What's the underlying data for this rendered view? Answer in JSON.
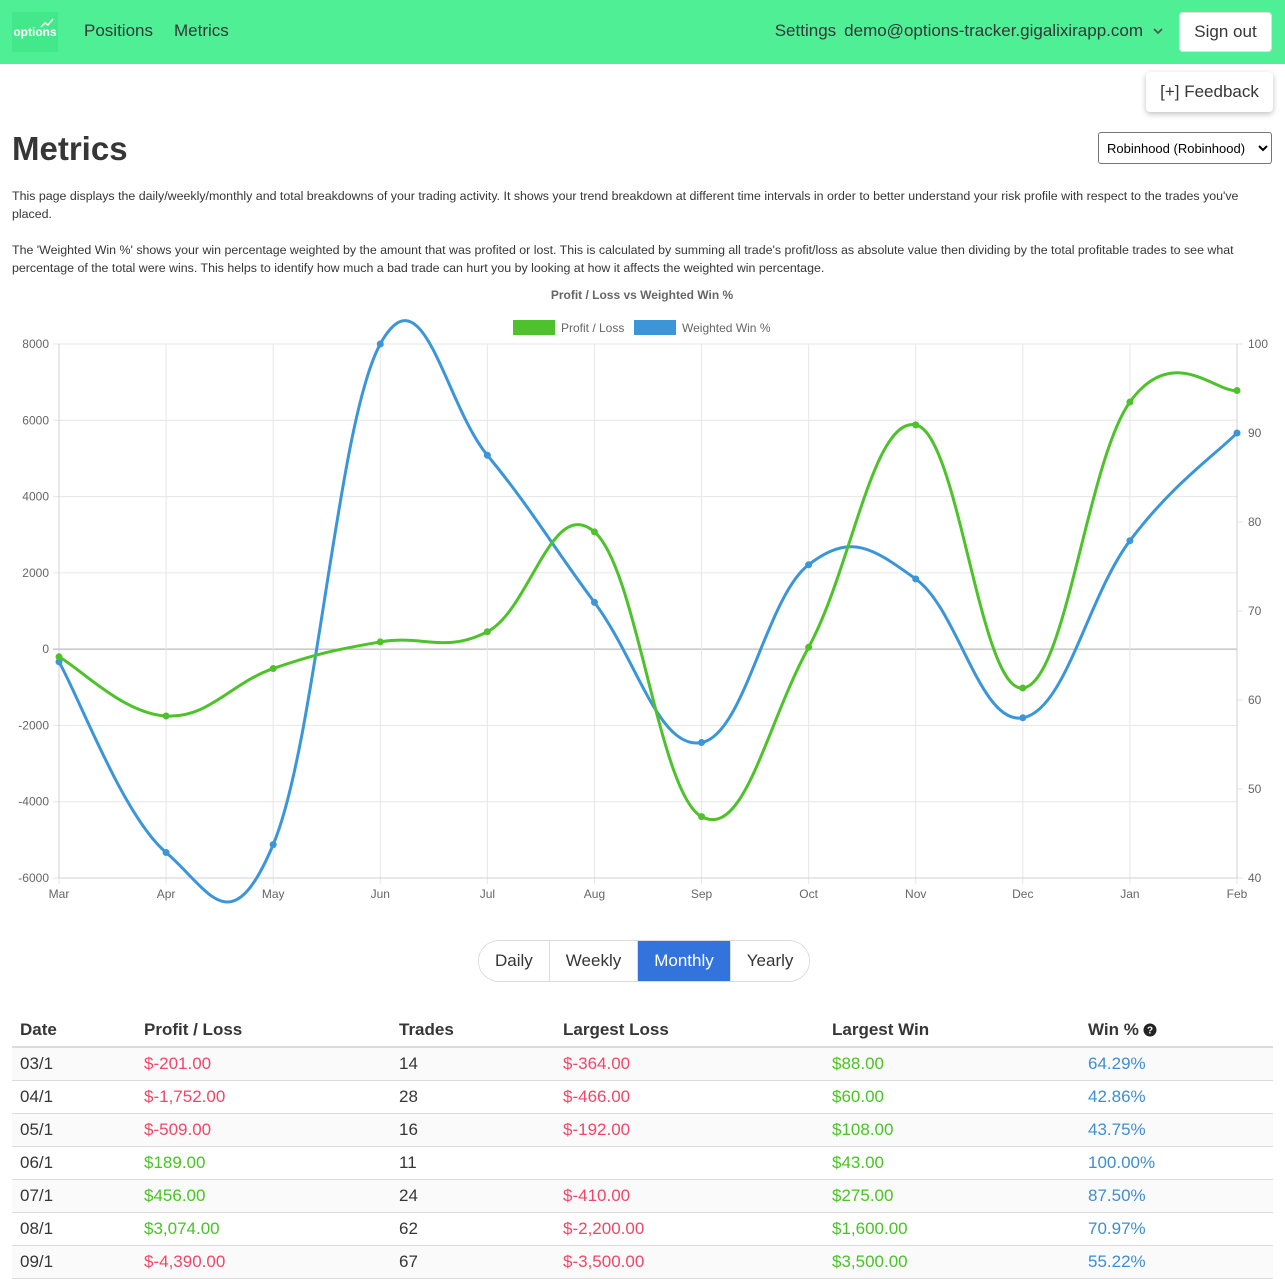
{
  "nav": {
    "logo_text": "options",
    "links": [
      "Positions",
      "Metrics"
    ],
    "settings_label": "Settings",
    "user_email": "demo@options-tracker.gigalixirapp.com",
    "sign_out": "Sign out",
    "brand_color": "#4ff095"
  },
  "feedback_label": "[+] Feedback",
  "page": {
    "title": "Metrics",
    "account_select": "Robinhood (Robinhood)",
    "paragraph1": "This page displays the daily/weekly/monthly and total breakdowns of your trading activity. It shows your trend breakdown at different time intervals in order to better understand your risk profile with respect to the trades you've placed.",
    "paragraph2": "The 'Weighted Win %' shows your win percentage weighted by the amount that was profited or lost. This is calculated by summing all trade's profit/loss as absolute value then dividing by the total profitable trades to see what percentage of the total were wins. This helps to identify how much a bad trade can hurt you by looking at how it affects the weighted win percentage."
  },
  "chart_data": {
    "type": "line",
    "title": "Profit / Loss vs Weighted Win %",
    "categories": [
      "Mar",
      "Apr",
      "May",
      "Jun",
      "Jul",
      "Aug",
      "Sep",
      "Oct",
      "Nov",
      "Dec",
      "Jan",
      "Feb"
    ],
    "series": [
      {
        "name": "Profit / Loss",
        "axis": "left",
        "color": "#4dc22a",
        "values": [
          -201,
          -1752,
          -509,
          189,
          456,
          3074,
          -4390,
          50,
          5880,
          -1020,
          6480,
          6780
        ]
      },
      {
        "name": "Weighted Win %",
        "axis": "right",
        "color": "#3a96d9",
        "values": [
          64.29,
          42.86,
          43.75,
          100.0,
          87.5,
          70.97,
          55.22,
          75.2,
          73.6,
          58.0,
          77.9,
          90.0
        ]
      }
    ],
    "y_left": {
      "min": -6000,
      "max": 8000,
      "ticks": [
        8000,
        6000,
        4000,
        2000,
        0,
        -2000,
        -4000,
        -6000
      ]
    },
    "y_right": {
      "min": 40,
      "max": 100,
      "ticks": [
        100,
        90,
        80,
        70,
        60,
        50,
        40
      ]
    },
    "legend_position": "top",
    "grid": true
  },
  "tabs": [
    {
      "label": "Daily",
      "active": false
    },
    {
      "label": "Weekly",
      "active": false
    },
    {
      "label": "Monthly",
      "active": true
    },
    {
      "label": "Yearly",
      "active": false
    }
  ],
  "table": {
    "headers": [
      "Date",
      "Profit / Loss",
      "Trades",
      "Largest Loss",
      "Largest Win",
      "Win %"
    ],
    "rows": [
      {
        "date": "03/1",
        "pl": "$-201.00",
        "pl_sign": "neg",
        "trades": "14",
        "loss": "$-364.00",
        "win": "$88.00",
        "pct": "64.29%"
      },
      {
        "date": "04/1",
        "pl": "$-1,752.00",
        "pl_sign": "neg",
        "trades": "28",
        "loss": "$-466.00",
        "win": "$60.00",
        "pct": "42.86%"
      },
      {
        "date": "05/1",
        "pl": "$-509.00",
        "pl_sign": "neg",
        "trades": "16",
        "loss": "$-192.00",
        "win": "$108.00",
        "pct": "43.75%"
      },
      {
        "date": "06/1",
        "pl": "$189.00",
        "pl_sign": "pos",
        "trades": "11",
        "loss": "",
        "win": "$43.00",
        "pct": "100.00%"
      },
      {
        "date": "07/1",
        "pl": "$456.00",
        "pl_sign": "pos",
        "trades": "24",
        "loss": "$-410.00",
        "win": "$275.00",
        "pct": "87.50%"
      },
      {
        "date": "08/1",
        "pl": "$3,074.00",
        "pl_sign": "pos",
        "trades": "62",
        "loss": "$-2,200.00",
        "win": "$1,600.00",
        "pct": "70.97%"
      },
      {
        "date": "09/1",
        "pl": "$-4,390.00",
        "pl_sign": "neg",
        "trades": "67",
        "loss": "$-3,500.00",
        "win": "$3,500.00",
        "pct": "55.22%"
      }
    ]
  }
}
